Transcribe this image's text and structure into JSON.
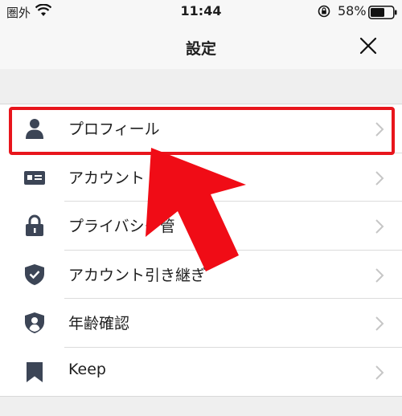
{
  "status_bar": {
    "carrier": "圏外",
    "time": "11:44",
    "battery": "58%"
  },
  "nav": {
    "title": "設定"
  },
  "menu": {
    "items": [
      {
        "label": "プロフィール",
        "icon": "person-icon"
      },
      {
        "label": "アカウント",
        "icon": "id-card-icon"
      },
      {
        "label": "プライバシー管",
        "icon": "lock-icon"
      },
      {
        "label": "アカウント引き継ぎ",
        "icon": "shield-check-icon"
      },
      {
        "label": "年齢確認",
        "icon": "shield-person-icon"
      },
      {
        "label": "Keep",
        "icon": "bookmark-icon"
      }
    ]
  },
  "annotation": {
    "highlight_color": "#e8151c",
    "arrow_color": "#f00c16"
  },
  "colors": {
    "icon": "#3c4556",
    "chevron": "#c6c6c6"
  }
}
